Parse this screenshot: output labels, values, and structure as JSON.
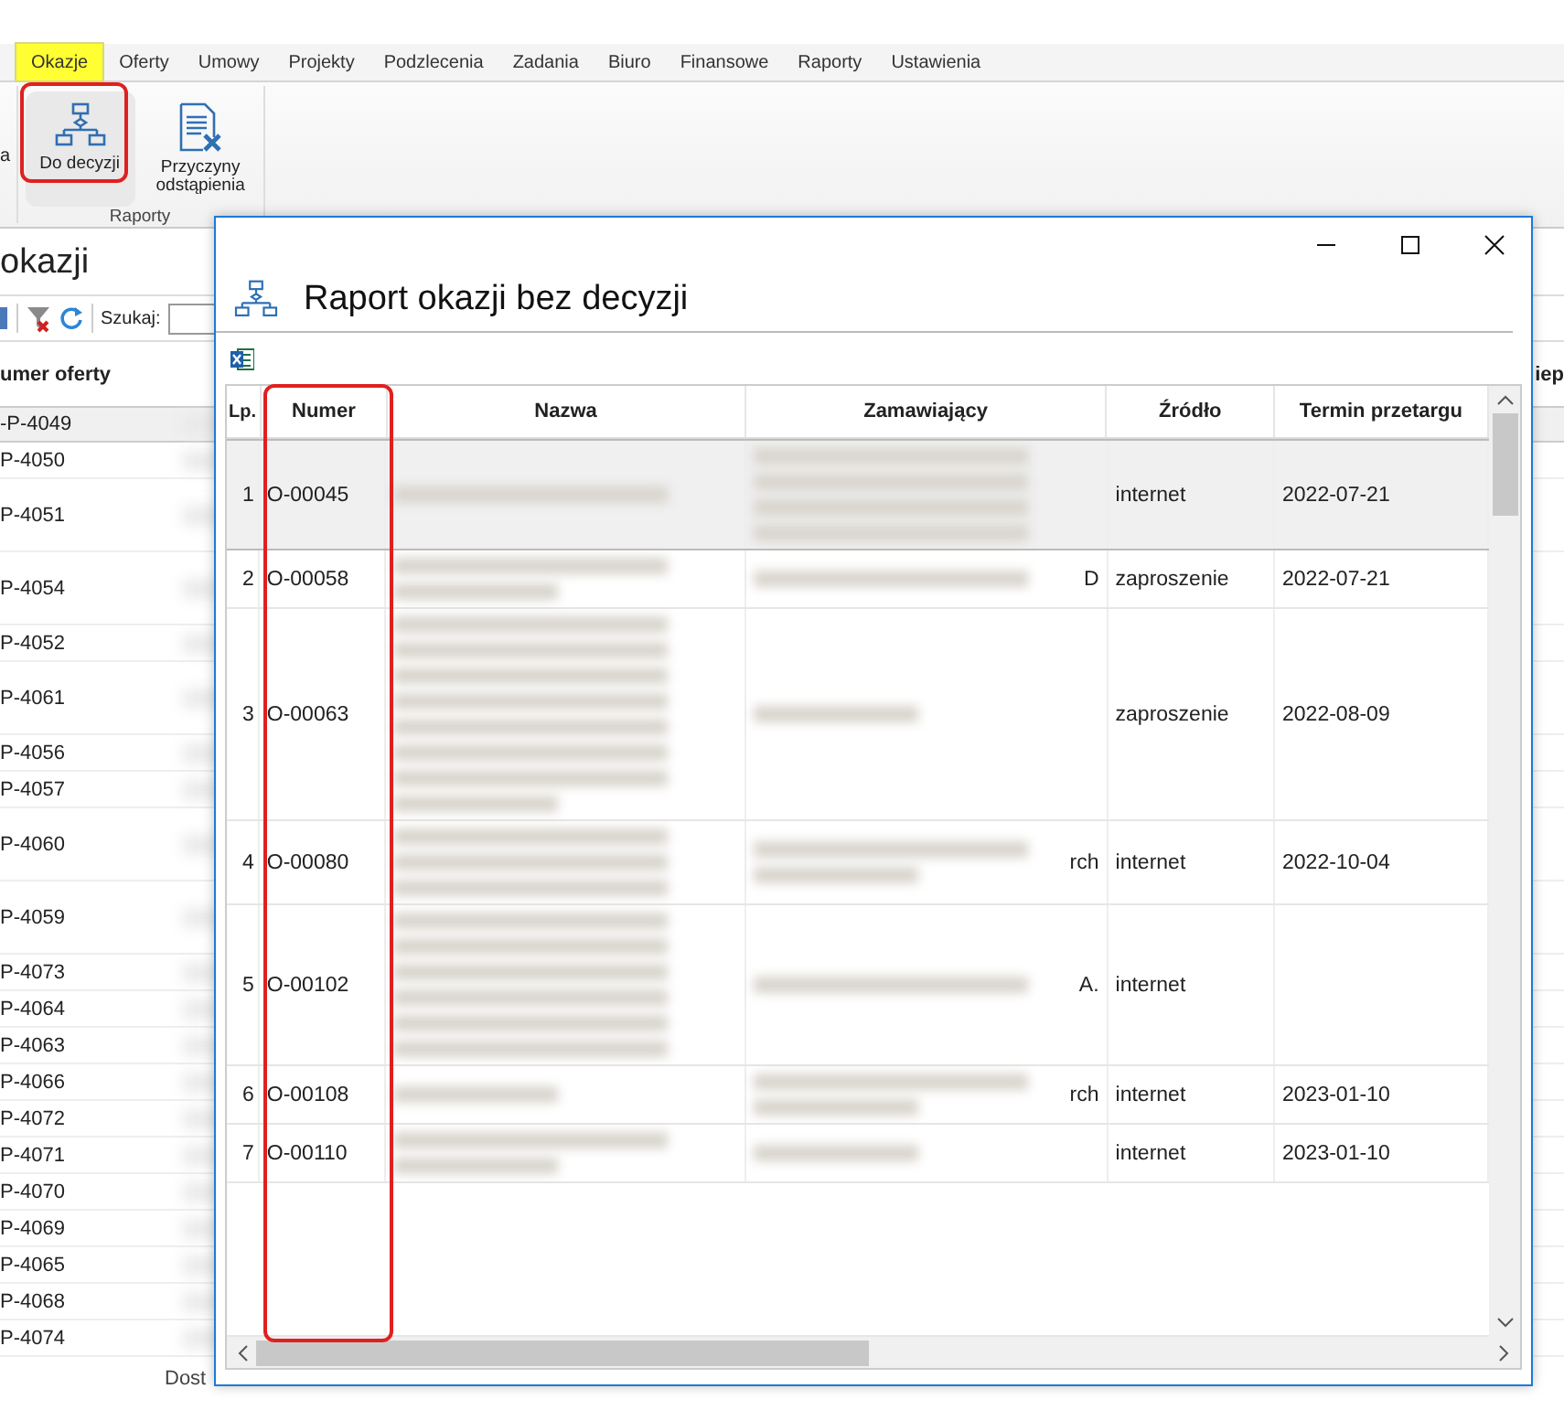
{
  "menu_tabs": [
    {
      "label": "Okazje",
      "selected": true
    },
    {
      "label": "Oferty",
      "selected": false
    },
    {
      "label": "Umowy",
      "selected": false
    },
    {
      "label": "Projekty",
      "selected": false
    },
    {
      "label": "Podzlecenia",
      "selected": false
    },
    {
      "label": "Zadania",
      "selected": false
    },
    {
      "label": "Biuro",
      "selected": false
    },
    {
      "label": "Finansowe",
      "selected": false
    },
    {
      "label": "Raporty",
      "selected": false
    },
    {
      "label": "Ustawienia",
      "selected": false
    }
  ],
  "ribbon": {
    "cut_label": "a",
    "group_label": "Raporty",
    "buttons": [
      {
        "kind": "flow",
        "label": "Do decyzji",
        "selected": true
      },
      {
        "kind": "doc",
        "label": "Przyczyny odstąpienia",
        "selected": false
      }
    ]
  },
  "background_view": {
    "title": "okazji",
    "search_label": "Szukaj:",
    "column_header": "umer oferty",
    "right_header": "iep",
    "footer_text": "Dost",
    "rows": [
      {
        "number": "-P-4049",
        "kind": "short"
      },
      {
        "number": "P-4050",
        "kind": "short"
      },
      {
        "number": "P-4051",
        "kind": "tall"
      },
      {
        "number": "P-4054",
        "kind": "tall"
      },
      {
        "number": "P-4052",
        "kind": "short"
      },
      {
        "number": "P-4061",
        "kind": "tall"
      },
      {
        "number": "P-4056",
        "kind": "short"
      },
      {
        "number": "P-4057",
        "kind": "short"
      },
      {
        "number": "P-4060",
        "kind": "tall"
      },
      {
        "number": "P-4059",
        "kind": "tall"
      },
      {
        "number": "P-4073",
        "kind": "short"
      },
      {
        "number": "P-4064",
        "kind": "short"
      },
      {
        "number": "P-4063",
        "kind": "short"
      },
      {
        "number": "P-4066",
        "kind": "short"
      },
      {
        "number": "P-4072",
        "kind": "short"
      },
      {
        "number": "P-4071",
        "kind": "short"
      },
      {
        "number": "P-4070",
        "kind": "short"
      },
      {
        "number": "P-4069",
        "kind": "short"
      },
      {
        "number": "P-4065",
        "kind": "short"
      },
      {
        "number": "P-4068",
        "kind": "short"
      },
      {
        "number": "P-4074",
        "kind": "short"
      }
    ]
  },
  "dialog": {
    "title": "Raport okazji bez decyzji",
    "columns": [
      "Lp.",
      "Numer",
      "Nazwa",
      "Zamawiający",
      "Źródło",
      "Termin przetargu"
    ],
    "rows": [
      {
        "lp": "1",
        "numer": "O-00045",
        "nazwa_lines": [
          true
        ],
        "zamawiajacy_lines": [
          true,
          true,
          true,
          true
        ],
        "zrodlo": "internet",
        "termin": "2022-07-21",
        "selected": true
      },
      {
        "lp": "2",
        "numer": "O-00058",
        "nazwa_lines": [
          true,
          false
        ],
        "zamawiajacy_lines": [
          true
        ],
        "zamawiajacy_tail": "D",
        "zrodlo": "zaproszenie",
        "termin": "2022-07-21",
        "selected": false
      },
      {
        "lp": "3",
        "numer": "O-00063",
        "nazwa_lines": [
          true,
          true,
          true,
          true,
          true,
          true,
          true,
          false
        ],
        "zamawiajacy_lines": [
          false
        ],
        "zrodlo": "zaproszenie",
        "termin": "2022-08-09",
        "selected": false
      },
      {
        "lp": "4",
        "numer": "O-00080",
        "nazwa_lines": [
          true,
          true,
          true
        ],
        "zamawiajacy_lines": [
          true,
          false
        ],
        "zamawiajacy_tail": "rch",
        "zrodlo": "internet",
        "termin": "2022-10-04",
        "selected": false
      },
      {
        "lp": "5",
        "numer": "O-00102",
        "nazwa_lines": [
          true,
          true,
          true,
          true,
          true,
          true
        ],
        "zamawiajacy_lines": [
          true
        ],
        "zamawiajacy_tail": "A.",
        "zrodlo": "internet",
        "selected": false
      },
      {
        "lp": "6",
        "numer": "O-00108",
        "nazwa_lines": [
          false
        ],
        "zamawiajacy_lines": [
          true,
          false
        ],
        "zamawiajacy_tail": "rch",
        "zrodlo": "internet",
        "termin": "2023-01-10",
        "selected": false
      },
      {
        "lp": "7",
        "numer": "O-00110",
        "nazwa_lines": [
          true,
          false
        ],
        "zamawiajacy_lines": [
          false
        ],
        "zrodlo": "internet",
        "termin": "2023-01-10",
        "selected": false
      }
    ]
  }
}
